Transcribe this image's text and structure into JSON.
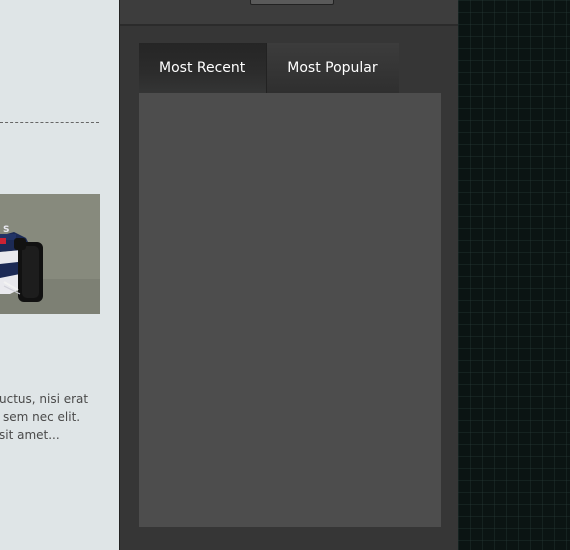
{
  "left": {
    "excerpt_lines": [
      "uctus, nisi erat",
      "sem nec elit.",
      "sit amet..."
    ]
  },
  "widget": {
    "tabs": [
      {
        "label": "Most Recent",
        "active": true
      },
      {
        "label": "Most Popular",
        "active": false
      }
    ]
  },
  "colors": {
    "left_bg": "#dfe5e7",
    "panel_bg": "#363636",
    "content_bg": "#4d4d4d",
    "right_bg": "#0b1413"
  }
}
